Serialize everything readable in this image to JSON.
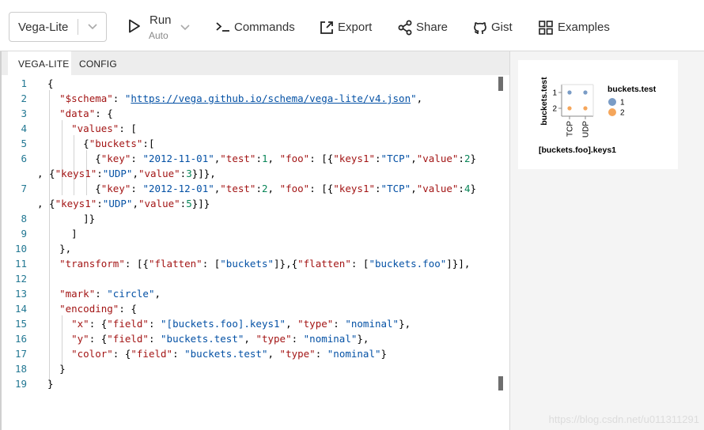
{
  "toolbar": {
    "mode_value": "Vega-Lite",
    "run_label": "Run",
    "run_sub": "Auto",
    "commands_label": "Commands",
    "export_label": "Export",
    "share_label": "Share",
    "gist_label": "Gist",
    "examples_label": "Examples"
  },
  "editor": {
    "tabs": [
      "VEGA-LITE",
      "CONFIG"
    ],
    "line_numbers": [
      "1",
      "2",
      "3",
      "4",
      "5",
      "6",
      "",
      "7",
      "",
      "8",
      "9",
      "10",
      "11",
      "12",
      "13",
      "14",
      "15",
      "16",
      "17",
      "18",
      "19"
    ]
  },
  "chart_data": {
    "type": "scatter",
    "x": [
      "TCP",
      "UDP"
    ],
    "y": [
      "1",
      "2"
    ],
    "points": [
      {
        "x": "TCP",
        "y": "1",
        "color": "1"
      },
      {
        "x": "UDP",
        "y": "1",
        "color": "1"
      },
      {
        "x": "TCP",
        "y": "2",
        "color": "2"
      },
      {
        "x": "UDP",
        "y": "2",
        "color": "2"
      }
    ],
    "xlabel": "[buckets.foo].keys1",
    "ylabel": "buckets.test",
    "legend_title": "buckets.test",
    "legend": [
      {
        "label": "1",
        "color": "#7a9cc6"
      },
      {
        "label": "2",
        "color": "#f5a65b"
      }
    ],
    "legend_placement": "right"
  },
  "watermark": "https://blog.csdn.net/u011311291"
}
